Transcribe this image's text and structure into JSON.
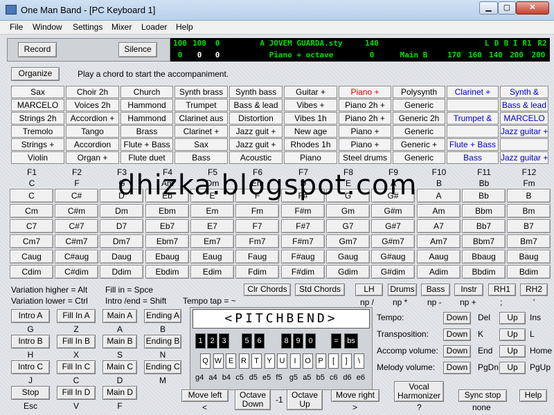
{
  "window": {
    "title": "One Man Band - [PC Keyboard 1]"
  },
  "menu": [
    "File",
    "Window",
    "Settings",
    "Mixer",
    "Loader",
    "Help"
  ],
  "toolbar": {
    "record": "Record",
    "silence": "Silence"
  },
  "display": {
    "row1": [
      "100",
      "100",
      "0",
      "A JOVEM GUARDA.sty",
      "140",
      "",
      "L",
      "D",
      "B",
      "I",
      "R1",
      "R2"
    ],
    "row2": [
      "0",
      "0",
      "0",
      "Piano + octave",
      "0",
      "Main B",
      "170",
      "160",
      "140",
      "200",
      "200"
    ]
  },
  "organize": "Organize",
  "status_message": "Play a chord to start the accompaniment.",
  "instruments": [
    [
      "Sax",
      "Choir 2h",
      "Church",
      "Synth brass",
      "Synth bass",
      "Guitar +",
      "Piano +",
      "Polysynth",
      "Clarinet +",
      "Synth &"
    ],
    [
      "MARCELO",
      "Voices 2h",
      "Hammond",
      "Trumpet",
      "Bass & lead",
      "Vibes +",
      "Piano 2h +",
      "Generic",
      "",
      "Bass & lead"
    ],
    [
      "Strings 2h",
      "Accordion +",
      "Hammond",
      "Clarinet aus",
      "Distortion",
      "Vibes 1h",
      "Piano 2h +",
      "Generic 2h",
      "Trumpet &",
      "MARCELO"
    ],
    [
      "Tremolo",
      "Tango",
      "Brass",
      "Clarinet +",
      "Jazz guit +",
      "New age",
      "Piano +",
      "Generic",
      "",
      "Jazz guitar +"
    ],
    [
      "Strings +",
      "Accordion",
      "Flute + Bass",
      "Sax",
      "Jazz guit +",
      "Rhodes 1h",
      "Piano +",
      "Generic +",
      "Flute + Bass",
      ""
    ],
    [
      "Violin",
      "Organ +",
      "Flute duet",
      "Bass",
      "Acoustic",
      "Piano",
      "Steel drums",
      "Generic",
      "Bass",
      "Jazz guitar +"
    ]
  ],
  "fkeys": [
    "F1",
    "F2",
    "F3",
    "F4",
    "F5",
    "F6",
    "F7",
    "F8",
    "F9",
    "F10",
    "F11",
    "F12"
  ],
  "fkey_chords": [
    "C",
    "F",
    "G",
    "Am",
    "Dm",
    "Em",
    "D",
    "E",
    "A",
    "B",
    "Bb",
    "Fm"
  ],
  "chords": [
    [
      "C",
      "C#",
      "D",
      "Eb",
      "E",
      "F",
      "F#",
      "G",
      "G#",
      "A",
      "Bb",
      "B"
    ],
    [
      "Cm",
      "C#m",
      "Dm",
      "Ebm",
      "Em",
      "Fm",
      "F#m",
      "Gm",
      "G#m",
      "Am",
      "Bbm",
      "Bm"
    ],
    [
      "C7",
      "C#7",
      "D7",
      "Eb7",
      "E7",
      "F7",
      "F#7",
      "G7",
      "G#7",
      "A7",
      "Bb7",
      "B7"
    ],
    [
      "Cm7",
      "C#m7",
      "Dm7",
      "Ebm7",
      "Em7",
      "Fm7",
      "F#m7",
      "Gm7",
      "G#m7",
      "Am7",
      "Bbm7",
      "Bm7"
    ],
    [
      "Caug",
      "C#aug",
      "Daug",
      "Ebaug",
      "Eaug",
      "Faug",
      "F#aug",
      "Gaug",
      "G#aug",
      "Aaug",
      "Bbaug",
      "Baug"
    ],
    [
      "Cdim",
      "C#dim",
      "Ddim",
      "Ebdim",
      "Edim",
      "Fdim",
      "F#dim",
      "Gdim",
      "G#dim",
      "Adim",
      "Bbdim",
      "Bdim"
    ]
  ],
  "watermark": "dhizka.blogspot.com",
  "hints": {
    "var_higher": "Variation higher = Alt",
    "var_lower": "Variation lower = Ctrl",
    "fill_in": "Fill in = Spce",
    "intro_end": "Intro /end = Shift",
    "tempo_tap": "Tempo tap = ~"
  },
  "top_buttons": {
    "clr": "Clr Chords",
    "std": "Std Chords",
    "lh": "LH",
    "drums": "Drums",
    "bass": "Bass",
    "instr": "Instr",
    "rh1": "RH1",
    "rh2": "RH2"
  },
  "numpad_labels": [
    "np /",
    "np *",
    "np -",
    "np +",
    ";",
    "'"
  ],
  "sections": [
    {
      "btns": [
        "Intro A",
        "Fill In A",
        "Main A",
        "Ending A"
      ],
      "keys": [
        "G",
        "Z",
        "A",
        "B"
      ]
    },
    {
      "btns": [
        "Intro B",
        "Fill In B",
        "Main B",
        "Ending B"
      ],
      "keys": [
        "H",
        "X",
        "S",
        "N"
      ]
    },
    {
      "btns": [
        "Intro C",
        "Fill In C",
        "Main C",
        "Ending C"
      ],
      "keys": [
        "J",
        "C",
        "D",
        "M"
      ]
    },
    {
      "btns": [
        "Stop",
        "Fill In D",
        "Main D",
        ""
      ],
      "keys": [
        "Esc",
        "V",
        "F",
        ""
      ]
    }
  ],
  "pitchbend": "<PITCHBEND>",
  "keyboard": {
    "top": [
      "1",
      "2",
      "3",
      "",
      "5",
      "6",
      "",
      "8",
      "9",
      "0",
      "",
      "=",
      "bs"
    ],
    "bottom": [
      "Q",
      "W",
      "E",
      "R",
      "T",
      "Y",
      "U",
      "I",
      "O",
      "P",
      "[",
      "]",
      "\\"
    ],
    "notes": [
      "g4",
      "a4",
      "b4",
      "c5",
      "d5",
      "e5",
      "f5",
      "g5",
      "a5",
      "b5",
      "c6",
      "d6",
      "e6"
    ]
  },
  "controls": [
    {
      "label": "Tempo:",
      "down": "Down",
      "down_key": "Del",
      "up": "Up",
      "up_key": "Ins"
    },
    {
      "label": "Transposition:",
      "down": "Down",
      "down_key": "K",
      "up": "Up",
      "up_key": "L"
    },
    {
      "label": "Accomp volume:",
      "down": "Down",
      "down_key": "End",
      "up": "Up",
      "up_key": "Home"
    },
    {
      "label": "Melody volume:",
      "down": "Down",
      "down_key": "PgDn",
      "up": "Up",
      "up_key": "PgUp"
    }
  ],
  "bottom": {
    "move_left": "Move left",
    "move_left_key": "<",
    "oct_down": "Octave Down",
    "oct_value": "-1",
    "oct_up": "Octave Up",
    "move_right": "Move right",
    "move_right_key": ">",
    "vocal": "Vocal Harmonizer",
    "vocal_key": "?",
    "sync": "Sync stop",
    "sync_key": "none",
    "help": "Help"
  },
  "colors": {
    "red": "#e00000",
    "blue": "#0000c8",
    "green_display": "#00e000"
  }
}
